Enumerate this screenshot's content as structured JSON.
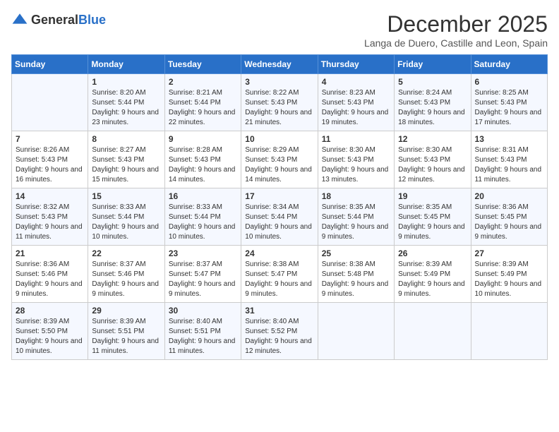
{
  "header": {
    "logo_general": "General",
    "logo_blue": "Blue",
    "month": "December 2025",
    "location": "Langa de Duero, Castille and Leon, Spain"
  },
  "days_of_week": [
    "Sunday",
    "Monday",
    "Tuesday",
    "Wednesday",
    "Thursday",
    "Friday",
    "Saturday"
  ],
  "weeks": [
    [
      {
        "day": "",
        "sunrise": "",
        "sunset": "",
        "daylight": ""
      },
      {
        "day": "1",
        "sunrise": "Sunrise: 8:20 AM",
        "sunset": "Sunset: 5:44 PM",
        "daylight": "Daylight: 9 hours and 23 minutes."
      },
      {
        "day": "2",
        "sunrise": "Sunrise: 8:21 AM",
        "sunset": "Sunset: 5:44 PM",
        "daylight": "Daylight: 9 hours and 22 minutes."
      },
      {
        "day": "3",
        "sunrise": "Sunrise: 8:22 AM",
        "sunset": "Sunset: 5:43 PM",
        "daylight": "Daylight: 9 hours and 21 minutes."
      },
      {
        "day": "4",
        "sunrise": "Sunrise: 8:23 AM",
        "sunset": "Sunset: 5:43 PM",
        "daylight": "Daylight: 9 hours and 19 minutes."
      },
      {
        "day": "5",
        "sunrise": "Sunrise: 8:24 AM",
        "sunset": "Sunset: 5:43 PM",
        "daylight": "Daylight: 9 hours and 18 minutes."
      },
      {
        "day": "6",
        "sunrise": "Sunrise: 8:25 AM",
        "sunset": "Sunset: 5:43 PM",
        "daylight": "Daylight: 9 hours and 17 minutes."
      }
    ],
    [
      {
        "day": "7",
        "sunrise": "Sunrise: 8:26 AM",
        "sunset": "Sunset: 5:43 PM",
        "daylight": "Daylight: 9 hours and 16 minutes."
      },
      {
        "day": "8",
        "sunrise": "Sunrise: 8:27 AM",
        "sunset": "Sunset: 5:43 PM",
        "daylight": "Daylight: 9 hours and 15 minutes."
      },
      {
        "day": "9",
        "sunrise": "Sunrise: 8:28 AM",
        "sunset": "Sunset: 5:43 PM",
        "daylight": "Daylight: 9 hours and 14 minutes."
      },
      {
        "day": "10",
        "sunrise": "Sunrise: 8:29 AM",
        "sunset": "Sunset: 5:43 PM",
        "daylight": "Daylight: 9 hours and 14 minutes."
      },
      {
        "day": "11",
        "sunrise": "Sunrise: 8:30 AM",
        "sunset": "Sunset: 5:43 PM",
        "daylight": "Daylight: 9 hours and 13 minutes."
      },
      {
        "day": "12",
        "sunrise": "Sunrise: 8:30 AM",
        "sunset": "Sunset: 5:43 PM",
        "daylight": "Daylight: 9 hours and 12 minutes."
      },
      {
        "day": "13",
        "sunrise": "Sunrise: 8:31 AM",
        "sunset": "Sunset: 5:43 PM",
        "daylight": "Daylight: 9 hours and 11 minutes."
      }
    ],
    [
      {
        "day": "14",
        "sunrise": "Sunrise: 8:32 AM",
        "sunset": "Sunset: 5:43 PM",
        "daylight": "Daylight: 9 hours and 11 minutes."
      },
      {
        "day": "15",
        "sunrise": "Sunrise: 8:33 AM",
        "sunset": "Sunset: 5:44 PM",
        "daylight": "Daylight: 9 hours and 10 minutes."
      },
      {
        "day": "16",
        "sunrise": "Sunrise: 8:33 AM",
        "sunset": "Sunset: 5:44 PM",
        "daylight": "Daylight: 9 hours and 10 minutes."
      },
      {
        "day": "17",
        "sunrise": "Sunrise: 8:34 AM",
        "sunset": "Sunset: 5:44 PM",
        "daylight": "Daylight: 9 hours and 10 minutes."
      },
      {
        "day": "18",
        "sunrise": "Sunrise: 8:35 AM",
        "sunset": "Sunset: 5:44 PM",
        "daylight": "Daylight: 9 hours and 9 minutes."
      },
      {
        "day": "19",
        "sunrise": "Sunrise: 8:35 AM",
        "sunset": "Sunset: 5:45 PM",
        "daylight": "Daylight: 9 hours and 9 minutes."
      },
      {
        "day": "20",
        "sunrise": "Sunrise: 8:36 AM",
        "sunset": "Sunset: 5:45 PM",
        "daylight": "Daylight: 9 hours and 9 minutes."
      }
    ],
    [
      {
        "day": "21",
        "sunrise": "Sunrise: 8:36 AM",
        "sunset": "Sunset: 5:46 PM",
        "daylight": "Daylight: 9 hours and 9 minutes."
      },
      {
        "day": "22",
        "sunrise": "Sunrise: 8:37 AM",
        "sunset": "Sunset: 5:46 PM",
        "daylight": "Daylight: 9 hours and 9 minutes."
      },
      {
        "day": "23",
        "sunrise": "Sunrise: 8:37 AM",
        "sunset": "Sunset: 5:47 PM",
        "daylight": "Daylight: 9 hours and 9 minutes."
      },
      {
        "day": "24",
        "sunrise": "Sunrise: 8:38 AM",
        "sunset": "Sunset: 5:47 PM",
        "daylight": "Daylight: 9 hours and 9 minutes."
      },
      {
        "day": "25",
        "sunrise": "Sunrise: 8:38 AM",
        "sunset": "Sunset: 5:48 PM",
        "daylight": "Daylight: 9 hours and 9 minutes."
      },
      {
        "day": "26",
        "sunrise": "Sunrise: 8:39 AM",
        "sunset": "Sunset: 5:49 PM",
        "daylight": "Daylight: 9 hours and 9 minutes."
      },
      {
        "day": "27",
        "sunrise": "Sunrise: 8:39 AM",
        "sunset": "Sunset: 5:49 PM",
        "daylight": "Daylight: 9 hours and 10 minutes."
      }
    ],
    [
      {
        "day": "28",
        "sunrise": "Sunrise: 8:39 AM",
        "sunset": "Sunset: 5:50 PM",
        "daylight": "Daylight: 9 hours and 10 minutes."
      },
      {
        "day": "29",
        "sunrise": "Sunrise: 8:39 AM",
        "sunset": "Sunset: 5:51 PM",
        "daylight": "Daylight: 9 hours and 11 minutes."
      },
      {
        "day": "30",
        "sunrise": "Sunrise: 8:40 AM",
        "sunset": "Sunset: 5:51 PM",
        "daylight": "Daylight: 9 hours and 11 minutes."
      },
      {
        "day": "31",
        "sunrise": "Sunrise: 8:40 AM",
        "sunset": "Sunset: 5:52 PM",
        "daylight": "Daylight: 9 hours and 12 minutes."
      },
      {
        "day": "",
        "sunrise": "",
        "sunset": "",
        "daylight": ""
      },
      {
        "day": "",
        "sunrise": "",
        "sunset": "",
        "daylight": ""
      },
      {
        "day": "",
        "sunrise": "",
        "sunset": "",
        "daylight": ""
      }
    ]
  ]
}
